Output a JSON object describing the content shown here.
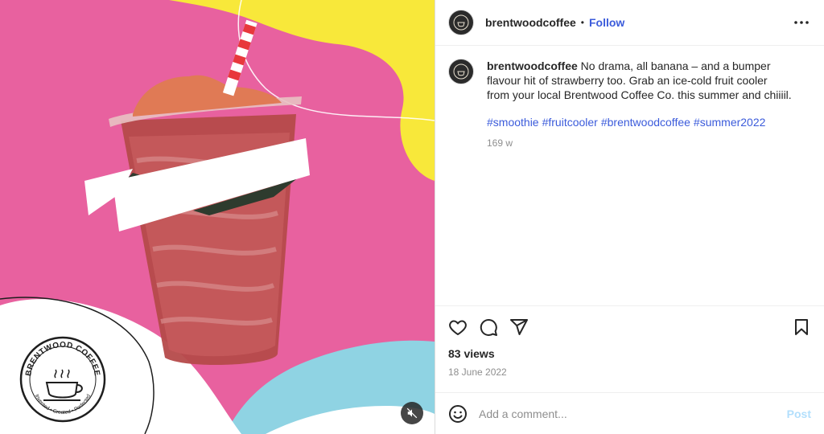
{
  "colors": {
    "media_pink": "#e8619f",
    "media_yellow": "#f8e83a",
    "media_blue": "#8fd3e3",
    "link_blue": "#3b5bdb",
    "post_disabled": "#b2dffc"
  },
  "media": {
    "logo": {
      "top_text": "BRENTWOOD COFFEE",
      "bottom_text": "Invented • Created • Perfected"
    },
    "mute_icon": "speaker-muted-icon"
  },
  "header": {
    "username": "brentwoodcoffee",
    "separator": "•",
    "follow_label": "Follow",
    "more_icon": "more-horizontal-icon"
  },
  "caption": {
    "username": "brentwoodcoffee",
    "text": "No drama, all banana – and a bumper flavour hit of strawberry too. Grab an ice-cold fruit cooler from your local Brentwood Coffee Co. this summer and chiiiil.",
    "hashtags": [
      "#smoothie",
      "#fruitcooler",
      "#brentwoodcoffee",
      "#summer2022"
    ],
    "age": "169 w"
  },
  "actions": {
    "like_icon": "heart-icon",
    "comment_icon": "comment-icon",
    "share_icon": "paper-plane-icon",
    "save_icon": "bookmark-icon"
  },
  "stats": {
    "views": "83 views",
    "date": "18 June 2022"
  },
  "comment_box": {
    "emoji_icon": "emoji-icon",
    "placeholder": "Add a comment...",
    "post_label": "Post"
  }
}
